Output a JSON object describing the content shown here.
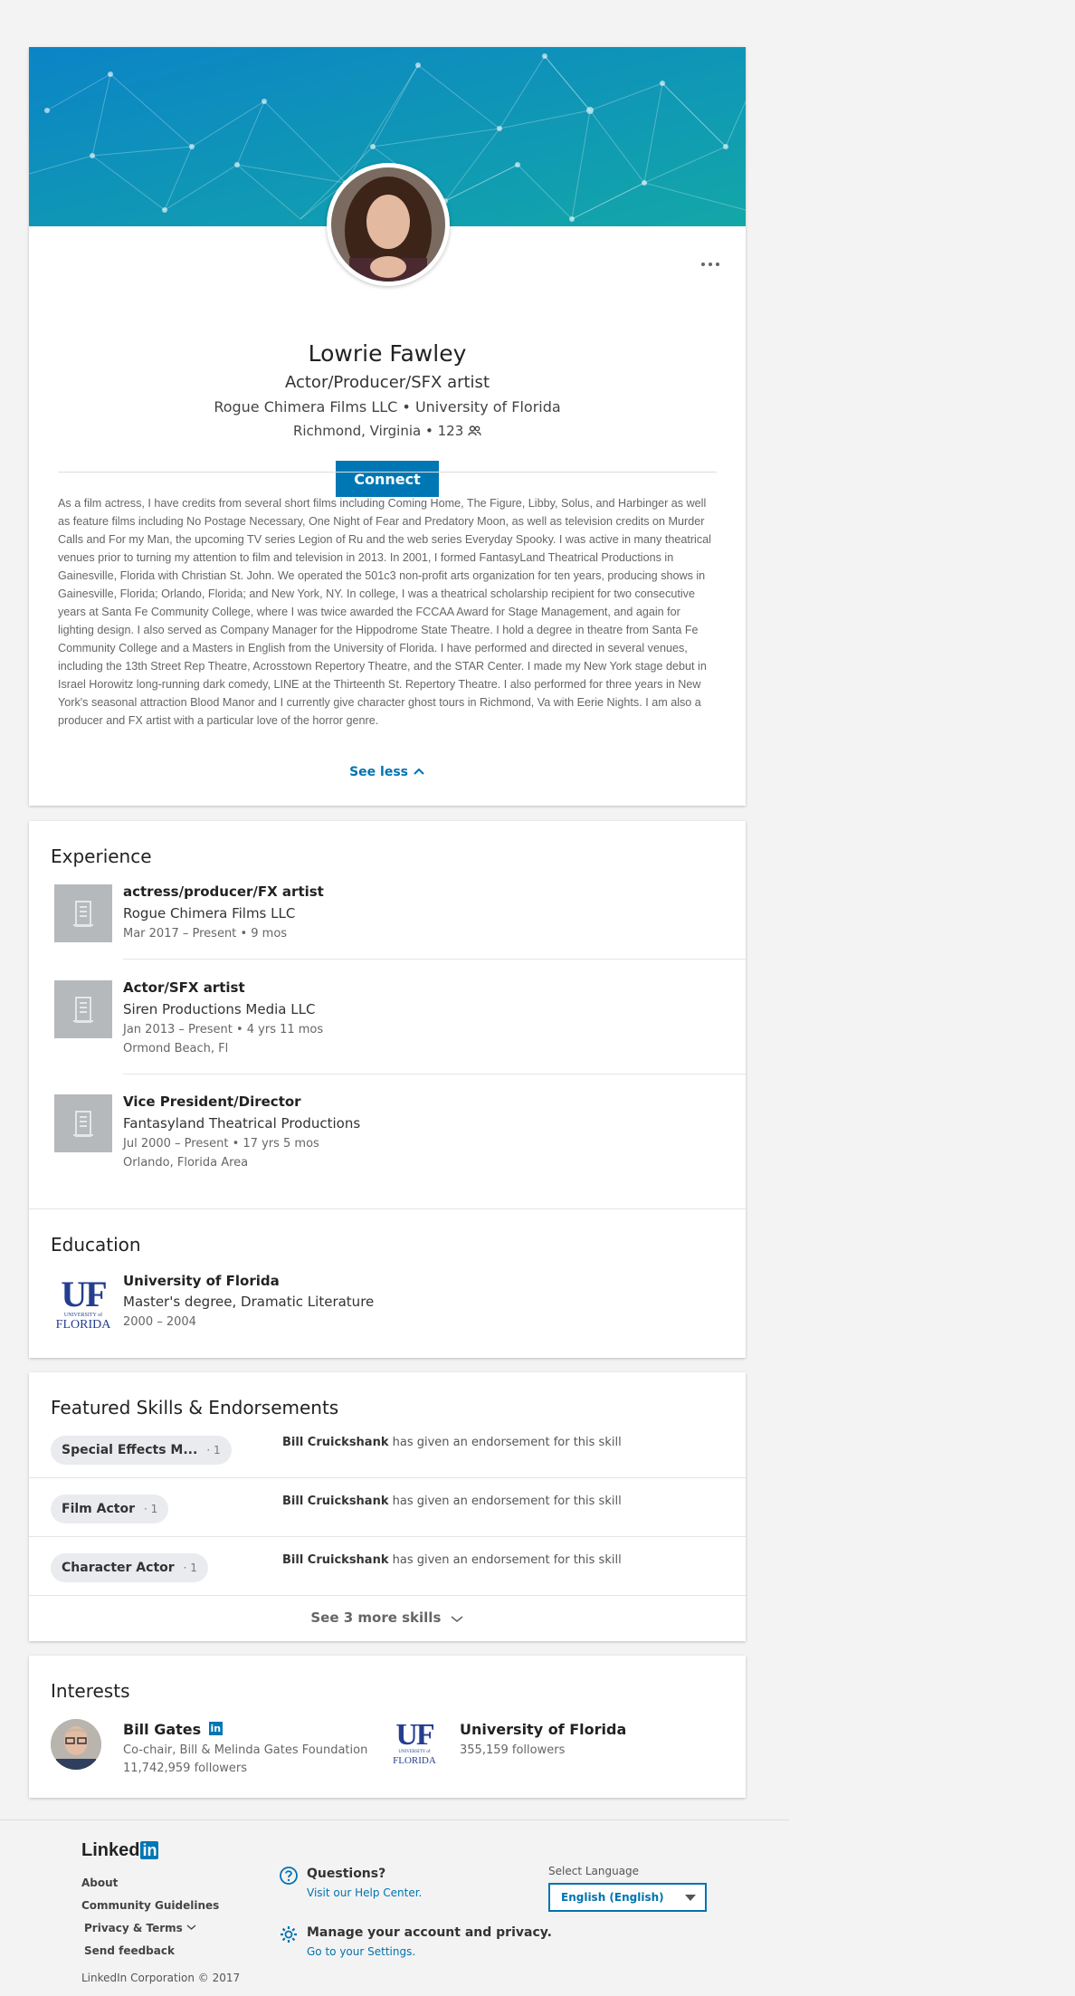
{
  "profile": {
    "name": "Lowrie Fawley",
    "headline": "Actor/Producer/SFX artist",
    "company": "Rogue Chimera Films LLC",
    "school": "University of Florida",
    "location": "Richmond, Virginia",
    "connections": "123",
    "connect_label": "Connect",
    "summary": "As a film actress, I have credits from several short films including Coming Home, The Figure, Libby, Solus, and Harbinger as well as feature films including No Postage Necessary, One Night of Fear and Predatory Moon, as well as television credits on Murder Calls and For my Man, the upcoming TV series Legion of Ru and the web series Everyday Spooky. I was active in many theatrical venues prior to turning my attention to film and television in 2013. In 2001, I formed FantasyLand Theatrical Productions in Gainesville, Florida with Christian St. John. We operated the 501c3 non-profit arts organization for ten years, producing shows in Gainesville, Florida; Orlando, Florida; and New York, NY. In college, I was a theatrical scholarship recipient for two consecutive years at Santa Fe Community College, where I was twice awarded the FCCAA Award for Stage Management, and again for lighting design. I also served as Company Manager for the Hippodrome State Theatre. I hold a degree in theatre from Santa Fe Community College and a Masters in English from the University of Florida. I have performed and directed in several venues, including the 13th Street Rep Theatre, Acrosstown Repertory Theatre, and the STAR Center. I made my New York stage debut in Israel Horowitz long-running dark comedy, LINE at the Thirteenth St. Repertory Theatre. I also performed for three years in New York's seasonal attraction Blood Manor and I currently give character ghost tours in Richmond, Va with Eerie Nights. I am also a producer and FX artist with a particular love of the horror genre.",
    "see_less": "See less"
  },
  "experience": {
    "title": "Experience",
    "items": [
      {
        "title": "actress/producer/FX artist",
        "company": "Rogue Chimera Films LLC",
        "dates": "Mar 2017 – Present",
        "duration": "9 mos",
        "location": ""
      },
      {
        "title": "Actor/SFX artist",
        "company": "Siren Productions Media LLC",
        "dates": "Jan 2013 – Present",
        "duration": "4 yrs 11 mos",
        "location": "Ormond Beach, Fl"
      },
      {
        "title": "Vice President/Director",
        "company": "Fantasyland Theatrical Productions",
        "dates": "Jul 2000 – Present",
        "duration": "17 yrs 5 mos",
        "location": "Orlando, Florida Area"
      }
    ]
  },
  "education": {
    "title": "Education",
    "school": "University of Florida",
    "degree": "Master's degree, Dramatic Literature",
    "dates": "2000 – 2004",
    "logo_text": "UF",
    "logo_sub1": "UNIVERSITY of",
    "logo_sub2": "FLORIDA"
  },
  "skills": {
    "title": "Featured Skills & Endorsements",
    "items": [
      {
        "name": "Special Effects M...",
        "count": "1",
        "endorser": "Bill Cruickshank",
        "endorse_text": "has given an endorsement for this skill"
      },
      {
        "name": "Film Actor",
        "count": "1",
        "endorser": "Bill Cruickshank",
        "endorse_text": "has given an endorsement for this skill"
      },
      {
        "name": "Character Actor",
        "count": "1",
        "endorser": "Bill Cruickshank",
        "endorse_text": "has given an endorsement for this skill"
      }
    ],
    "see_more": "See 3 more skills"
  },
  "interests": {
    "title": "Interests",
    "items": [
      {
        "name": "Bill Gates",
        "line1": "Co-chair, Bill & Melinda Gates Foundation",
        "line2": "11,742,959 followers"
      },
      {
        "name": "University of Florida",
        "line1": "355,159 followers",
        "line2": ""
      }
    ]
  },
  "footer": {
    "brand_text": "Linked",
    "brand_box": "in",
    "links": [
      "About",
      "Community Guidelines",
      "Privacy & Terms",
      "Send feedback"
    ],
    "copyright": "LinkedIn Corporation © 2017",
    "questions_head": "Questions?",
    "questions_sub": "Visit our Help Center.",
    "account_head": "Manage your account and privacy.",
    "account_sub": "Go to your Settings.",
    "language_label": "Select Language",
    "language_value": "English (English)"
  },
  "colors": {
    "accent": "#0077b5",
    "banner_start": "#0b84c6",
    "banner_end": "#13a7a8"
  }
}
